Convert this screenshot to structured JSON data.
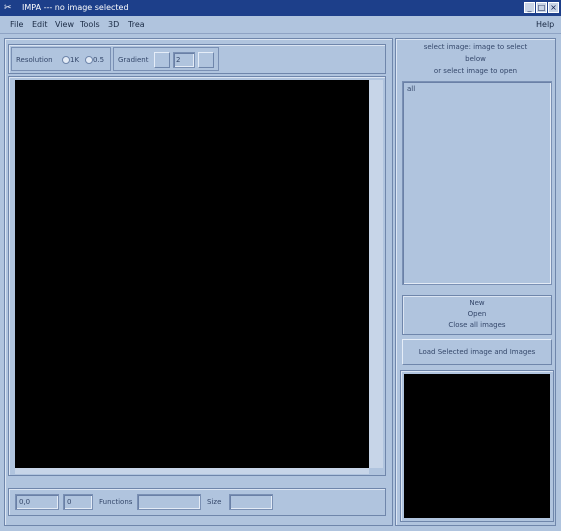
{
  "window": {
    "title": "IMPA --- no image selected",
    "logo_glyph": "✂"
  },
  "menu": {
    "items": [
      "File",
      "Edit",
      "View",
      "Tools",
      "3D",
      "Trea"
    ],
    "help": "Help"
  },
  "toolbar": {
    "resolution_label": "Resolution",
    "radio_options": [
      "1K",
      "0.5"
    ],
    "gradient_label": "Gradient",
    "gradient_value": "2"
  },
  "statusbar": {
    "coords_value": "0,0",
    "value_field": "0",
    "functions_label": "Functions",
    "size_label": "Size",
    "functions_value": "",
    "size_value": ""
  },
  "right_panel": {
    "info_lines": [
      "select image: image to select",
      "below",
      "or select image to open"
    ],
    "list_items": [
      "all"
    ],
    "button_group_lines": [
      "New",
      "Open",
      "Close all images"
    ],
    "load_button_label": "Load Selected image and Images"
  },
  "colors": {
    "titlebar_bg": "#1d3f8a",
    "panel_bg": "#b0c4de",
    "canvas_bg": "#000000"
  }
}
